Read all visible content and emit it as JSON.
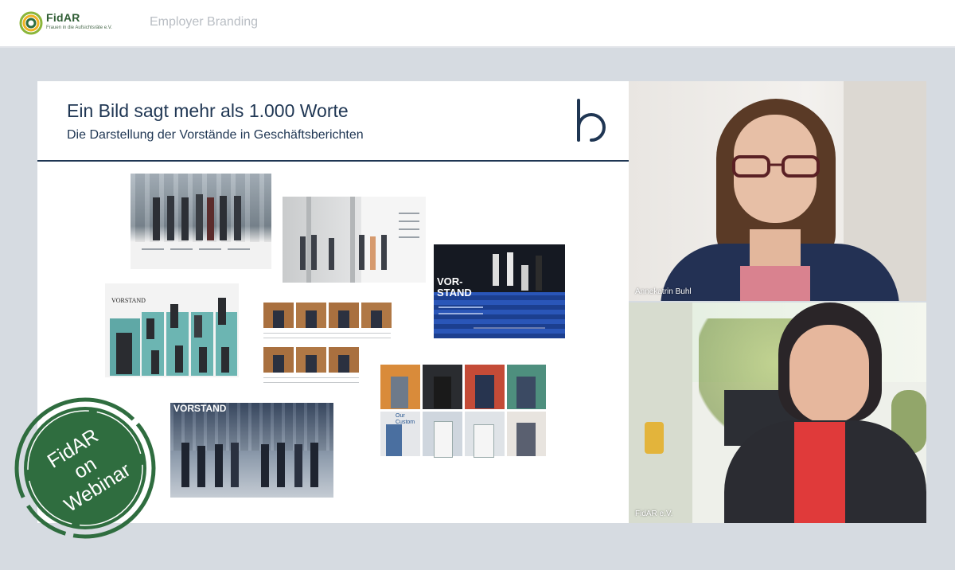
{
  "header": {
    "logo": {
      "name": "FidAR",
      "tagline": "Frauen in die Aufsichtsräte e.V.",
      "colors": [
        "#8bb63a",
        "#f0b323",
        "#2f6d3f"
      ]
    },
    "section_title": "Employer Branding"
  },
  "slide": {
    "title": "Ein Bild sagt mehr als 1.000 Worte",
    "subtitle": "Die Darstellung der Vorstände in Geschäftsberichten",
    "brand_icon": "letter-b-logo-icon",
    "accent_color": "#1f3653",
    "report_thumbnails": [
      {
        "id": "report-1",
        "label": ""
      },
      {
        "id": "report-2",
        "label": ""
      },
      {
        "id": "report-3",
        "label": "VORSTAND"
      },
      {
        "id": "report-4",
        "label": "VOR-\nSTAND"
      },
      {
        "id": "report-5",
        "label": ""
      },
      {
        "id": "report-6",
        "label": "Our Custom"
      },
      {
        "id": "report-7",
        "label": "VORSTAND"
      }
    ]
  },
  "badge": {
    "lines": [
      "FidAR",
      "on",
      "Webinar"
    ],
    "color": "#2f6d3f"
  },
  "participants": [
    {
      "name": "Annekatrin Buhl"
    },
    {
      "name": "FidAR e.V."
    }
  ]
}
